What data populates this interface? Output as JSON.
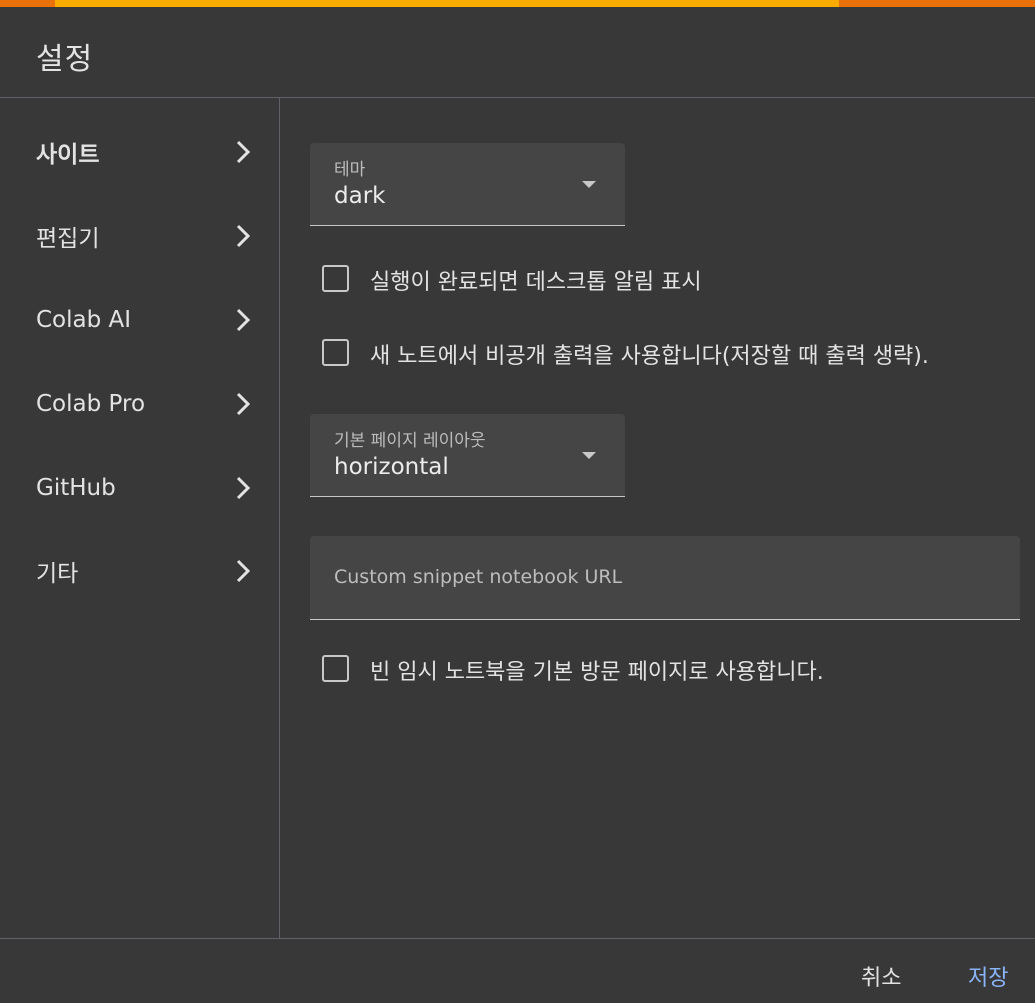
{
  "dialog": {
    "title": "설정",
    "progress": 0.8
  },
  "sidebar": {
    "items": [
      {
        "label": "사이트",
        "active": true
      },
      {
        "label": "편집기"
      },
      {
        "label": "Colab AI"
      },
      {
        "label": "Colab Pro"
      },
      {
        "label": "GitHub"
      },
      {
        "label": "기타"
      }
    ]
  },
  "main": {
    "theme": {
      "label": "테마",
      "value": "dark"
    },
    "desktop_notify": {
      "label": "실행이 완료되면 데스크톱 알림 표시",
      "checked": false
    },
    "private_outputs": {
      "label": "새 노트에서 비공개 출력을 사용합니다(저장할 때 출력 생략).",
      "checked": false
    },
    "layout": {
      "label": "기본 페이지 레이아웃",
      "value": "horizontal"
    },
    "snippet_url": {
      "placeholder": "Custom snippet notebook URL",
      "value": ""
    },
    "scratch_landing": {
      "label": "빈 임시 노트북을 기본 방문 페이지로 사용합니다.",
      "checked": false
    }
  },
  "footer": {
    "cancel_label": "취소",
    "save_label": "저장"
  },
  "colors": {
    "background": "#383838",
    "accent": "#8ab4f8",
    "progress_fill": "#f9ab00",
    "progress_track": "#e8710a"
  }
}
